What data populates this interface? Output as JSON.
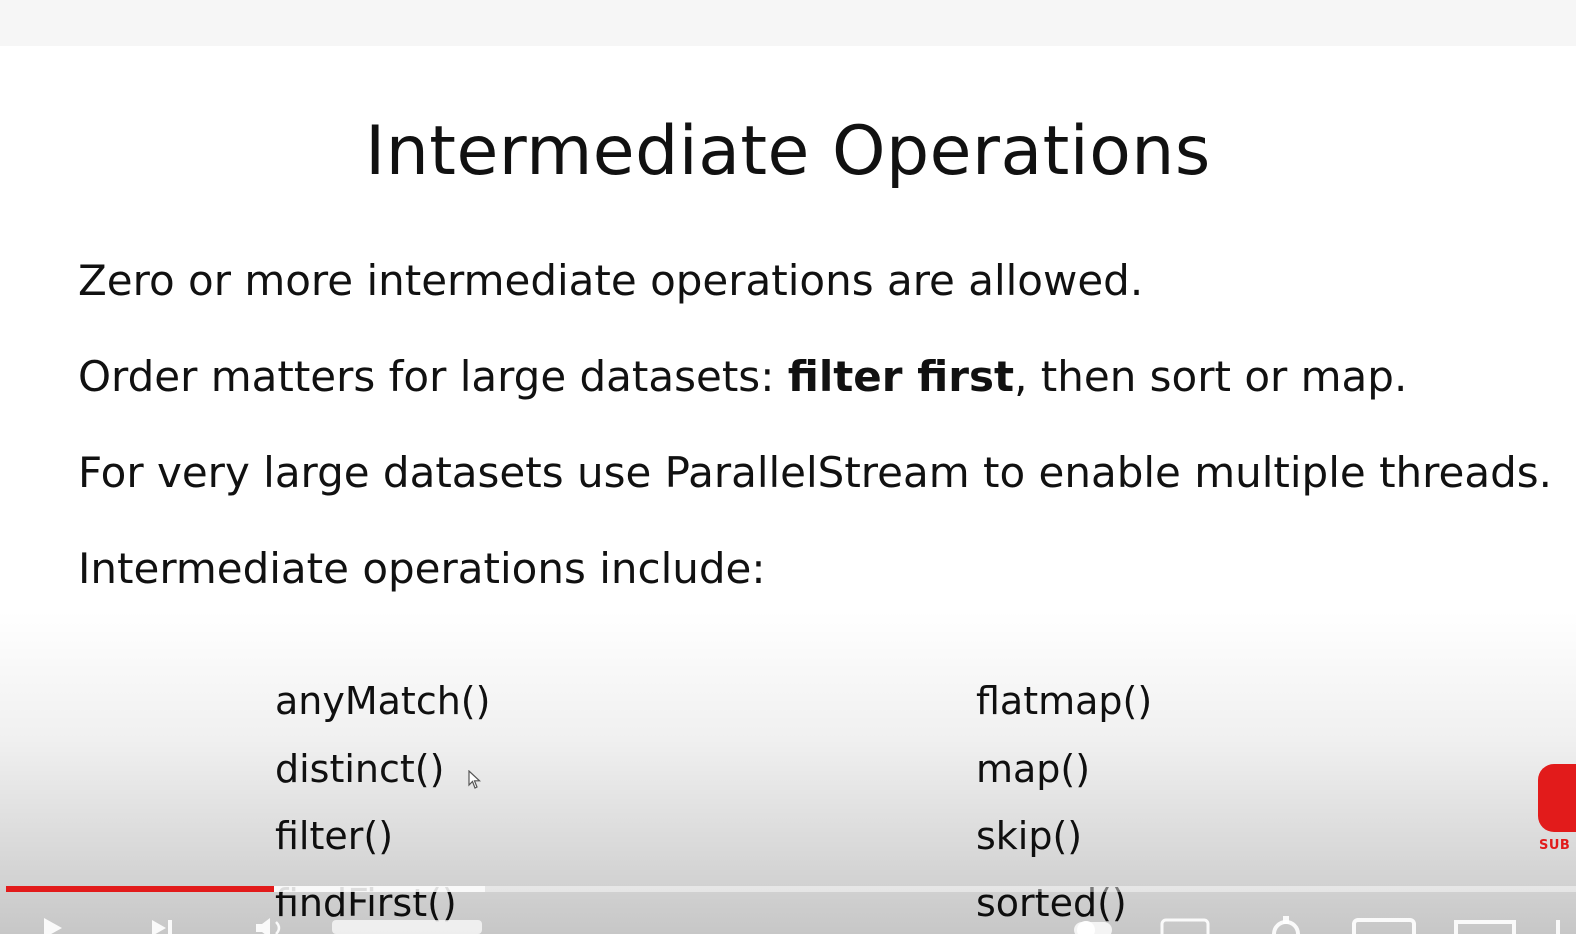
{
  "slide": {
    "title": "Intermediate Operations",
    "bullets": {
      "b1": "Zero or more intermediate operations are allowed.",
      "b2_before": "Order matters for large datasets: ",
      "b2_bold": "filter first",
      "b2_after": ", then sort or map.",
      "b3": "For very large datasets use ParallelStream to enable multiple threads.",
      "b4": "Intermediate operations include:"
    },
    "operations": {
      "left": [
        "anyMatch()",
        "distinct()",
        "filter()",
        "findFirst()"
      ],
      "right": [
        "flatmap()",
        "map()",
        "skip()",
        "sorted()"
      ]
    }
  },
  "player": {
    "progress": {
      "played_fraction": 0.171,
      "buffered_fraction": 0.305,
      "played_color": "#e21b1b"
    },
    "subscribe_label": "SUB",
    "controls": [
      "play-icon",
      "next-icon",
      "volume-icon",
      "autoplay-toggle",
      "subtitles-icon",
      "settings-icon",
      "miniplayer-icon",
      "theater-icon",
      "fullscreen-icon"
    ]
  },
  "colors": {
    "text": "#111111",
    "accent": "#e21b1b"
  }
}
